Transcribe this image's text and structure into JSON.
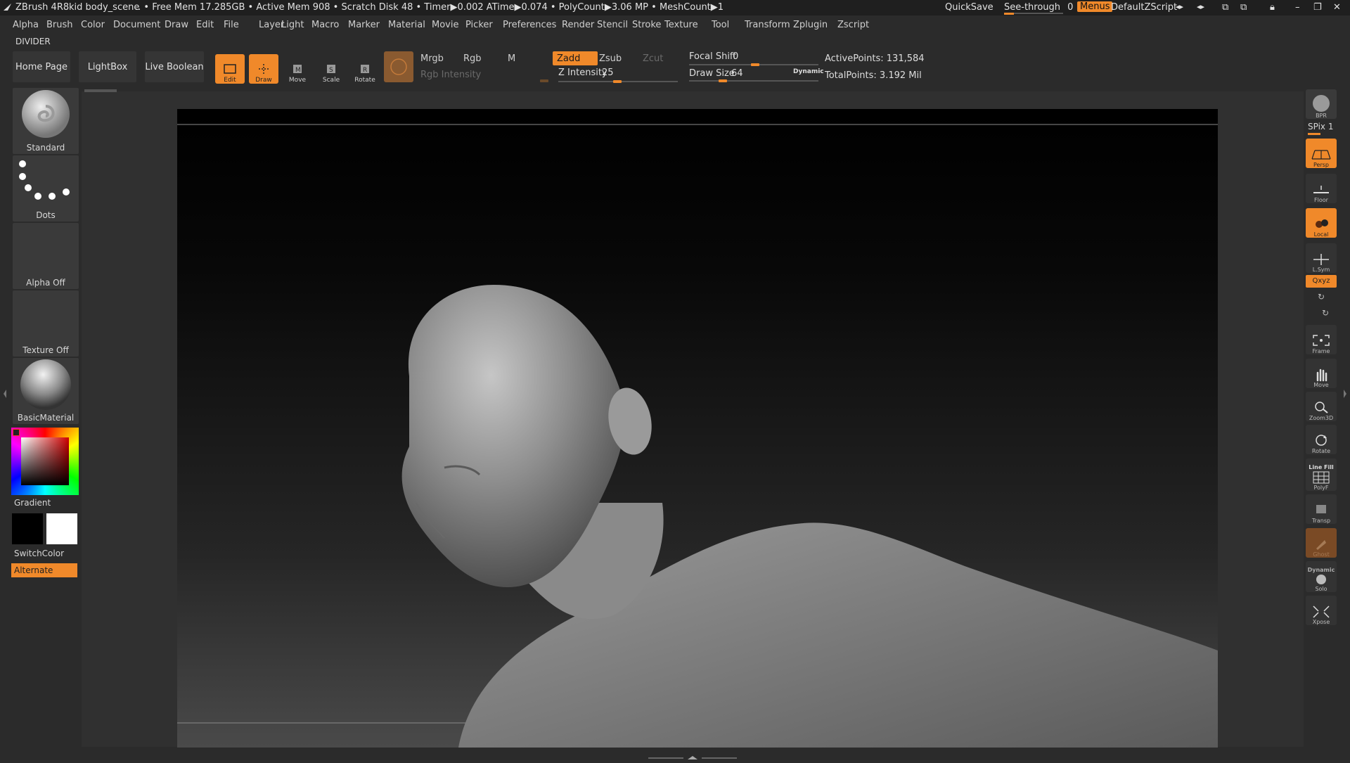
{
  "titlebar": {
    "app": "ZBrush 4R8",
    "document": "kid body_scene",
    "stats": ".. • Free Mem 17.285GB • Active Mem 908 • Scratch Disk 48 • Timer▶0.002 ATime▶0.074 • PolyCount▶3.06 MP • MeshCount▶1",
    "quicksave": "QuickSave",
    "see_through_label": "See-through",
    "see_through_value": "0",
    "menus": "Menus",
    "zscript": "DefaultZScript"
  },
  "menubar": [
    "Alpha",
    "Brush",
    "Color",
    "Document",
    "Draw",
    "Edit",
    "File",
    "Layer",
    "Light",
    "Macro",
    "Marker",
    "Material",
    "Movie",
    "Picker",
    "Preferences",
    "Render",
    "Stencil",
    "Stroke",
    "Texture",
    "Tool",
    "Transform",
    "Zplugin",
    "Zscript"
  ],
  "divider_label": "DIVIDER",
  "shelf": {
    "home": "Home Page",
    "lightbox": "LightBox",
    "live_boolean": "Live Boolean",
    "edit": "Edit",
    "draw": "Draw",
    "move": "Move",
    "scale": "Scale",
    "rotate": "Rotate",
    "mrgb": "Mrgb",
    "rgb": "Rgb",
    "m": "M",
    "rgb_intensity": "Rgb Intensity",
    "zadd": "Zadd",
    "zsub": "Zsub",
    "zcut": "Zcut",
    "z_intensity_label": "Z Intensity",
    "z_intensity_value": "25",
    "focal_shift_label": "Focal Shift",
    "focal_shift_value": "0",
    "draw_size_label": "Draw Size",
    "draw_size_value": "64",
    "dynamic": "Dynamic",
    "active_points": "ActivePoints: 131,584",
    "total_points": "TotalPoints: 3.192 Mil"
  },
  "left_tray": {
    "brush": "Standard",
    "stroke": "Dots",
    "alpha": "Alpha Off",
    "texture": "Texture Off",
    "material": "BasicMaterial",
    "gradient": "Gradient",
    "switch_color": "SwitchColor",
    "alternate": "Alternate"
  },
  "right_tray": {
    "bpr": "BPR",
    "spix": "SPix 1",
    "persp": "Persp",
    "floor": "Floor",
    "local": "Local",
    "lsym": "L.Sym",
    "xyz": "Qxyz",
    "frame": "Frame",
    "move": "Move",
    "zoom3d": "Zoom3D",
    "rotate": "Rotate",
    "line_fill": "Line Fill",
    "polyf": "PolyF",
    "transp": "Transp",
    "ghost": "Ghost",
    "dynamic": "Dynamic",
    "solo": "Solo",
    "xpose": "Xpose"
  },
  "colors": {
    "accent": "#f0892a",
    "background": "#2b2b2b",
    "canvas_top": "#000000"
  }
}
